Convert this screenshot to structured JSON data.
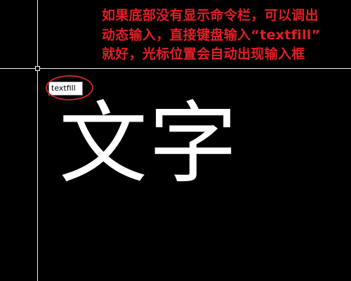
{
  "annotation": {
    "lines": [
      "如果底部没有显示命令栏，可以调出",
      "动态输入，直接键盘输入“textfill”",
      "就好，光标位置会自动出现输入框"
    ],
    "color": "#e21f26"
  },
  "dynamic_input": {
    "value": "textfill"
  },
  "drawing": {
    "text": "文字",
    "background": "#000000",
    "crosshair_color": "#f2f2f2"
  },
  "highlight": {
    "color": "#c1272d"
  }
}
